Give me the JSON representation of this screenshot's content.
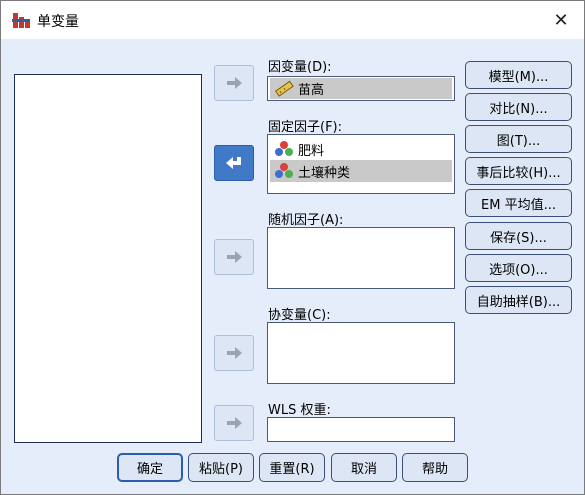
{
  "window": {
    "title": "单变量",
    "close_glyph": "✕"
  },
  "fields": {
    "dependent": {
      "label": "因变量(D):",
      "items": [
        {
          "label": "苗高",
          "icon": "ruler-icon"
        }
      ]
    },
    "fixed": {
      "label": "固定因子(F):",
      "items": [
        {
          "label": "肥料",
          "icon": "nominal-icon"
        },
        {
          "label": "土壤种类",
          "icon": "nominal-icon",
          "selected": true
        }
      ]
    },
    "random": {
      "label": "随机因子(A):"
    },
    "covariate": {
      "label": "协变量(C):"
    },
    "wls": {
      "label": "WLS 权重:"
    }
  },
  "side_buttons": [
    "模型(M)...",
    "对比(N)...",
    "图(T)...",
    "事后比较(H)...",
    "EM 平均值...",
    "保存(S)...",
    "选项(O)...",
    "自助抽样(B)..."
  ],
  "bottom_buttons": [
    "确定",
    "粘贴(P)",
    "重置(R)",
    "取消",
    "帮助"
  ],
  "colors": {
    "accent": "#3f79c8",
    "dialog_bg": "#e4edf9",
    "selection": "#c9c9c9"
  }
}
